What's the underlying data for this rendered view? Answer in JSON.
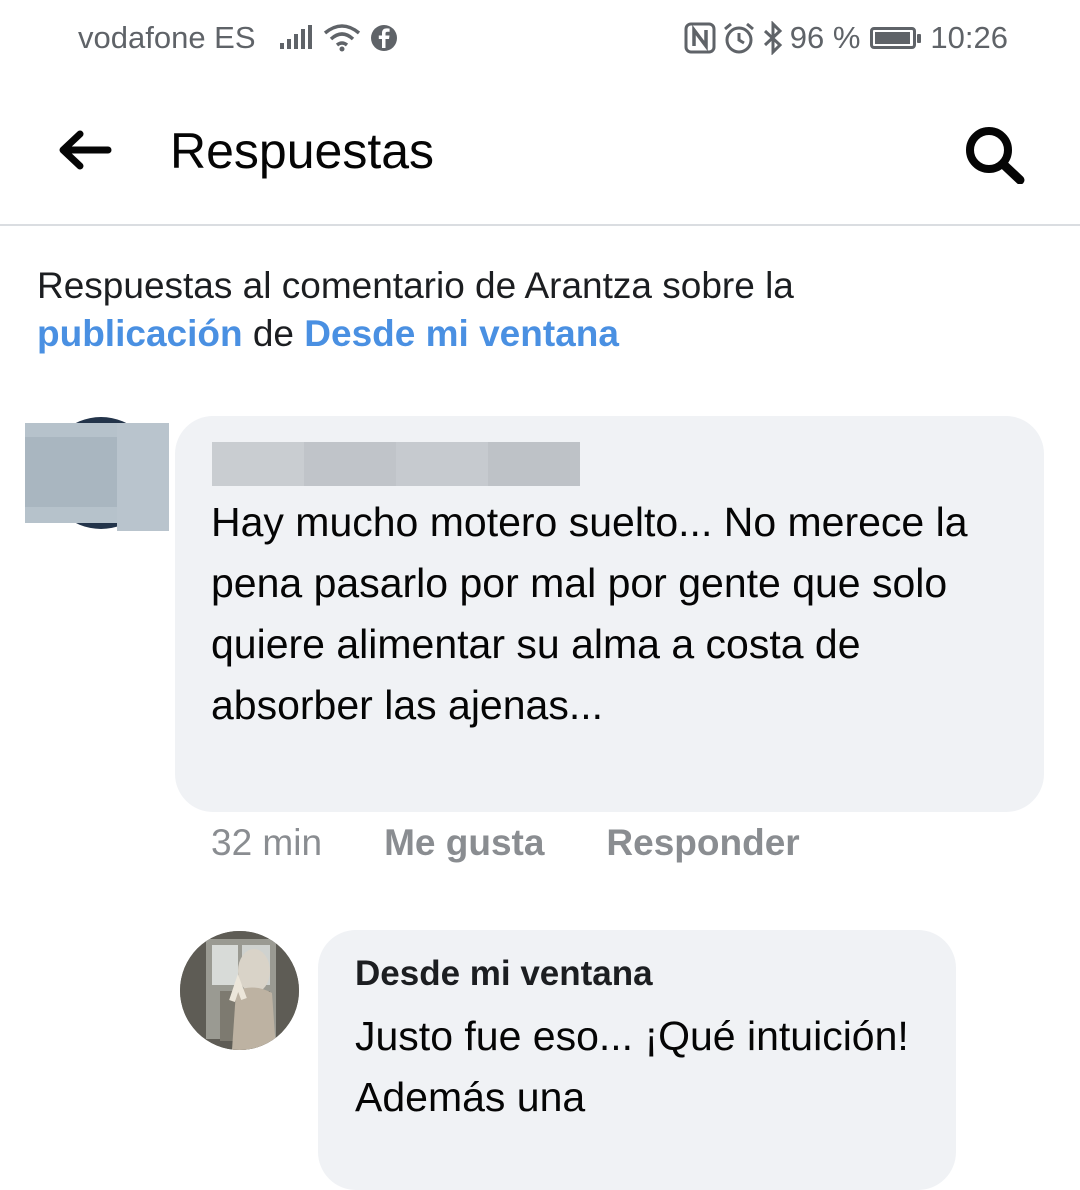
{
  "status_bar": {
    "carrier": "vodafone ES",
    "battery_percent": "96 %",
    "battery_level": 0.96,
    "time": "10:26",
    "icons": [
      "signal-icon",
      "wifi-icon",
      "facebook-icon",
      "nfc-icon",
      "alarm-icon",
      "bluetooth-icon",
      "battery-icon"
    ]
  },
  "app_bar": {
    "title": "Respuestas",
    "back_icon": "arrow-left-icon",
    "search_icon": "search-icon"
  },
  "context": {
    "prefix": "Respuestas al comentario de Arantza sobre la",
    "post_link": "publicación",
    "connector": "de",
    "page_link": "Desde mi ventana"
  },
  "comment": {
    "author_redacted": true,
    "text": "Hay mucho motero suelto... No merece la pena pasarlo por mal por gente que solo quiere alimentar su alma a costa de absorber las ajenas...",
    "time": "32 min",
    "like_label": "Me gusta",
    "reply_label": "Responder"
  },
  "reply": {
    "author": "Desde mi ventana",
    "text": "Justo fue eso... ¡Qué intuición! Además una"
  },
  "colors": {
    "link": "#4a90e2",
    "bubble": "#f0f2f5",
    "meta_text": "#8a8d91",
    "divider": "#dadde1"
  }
}
